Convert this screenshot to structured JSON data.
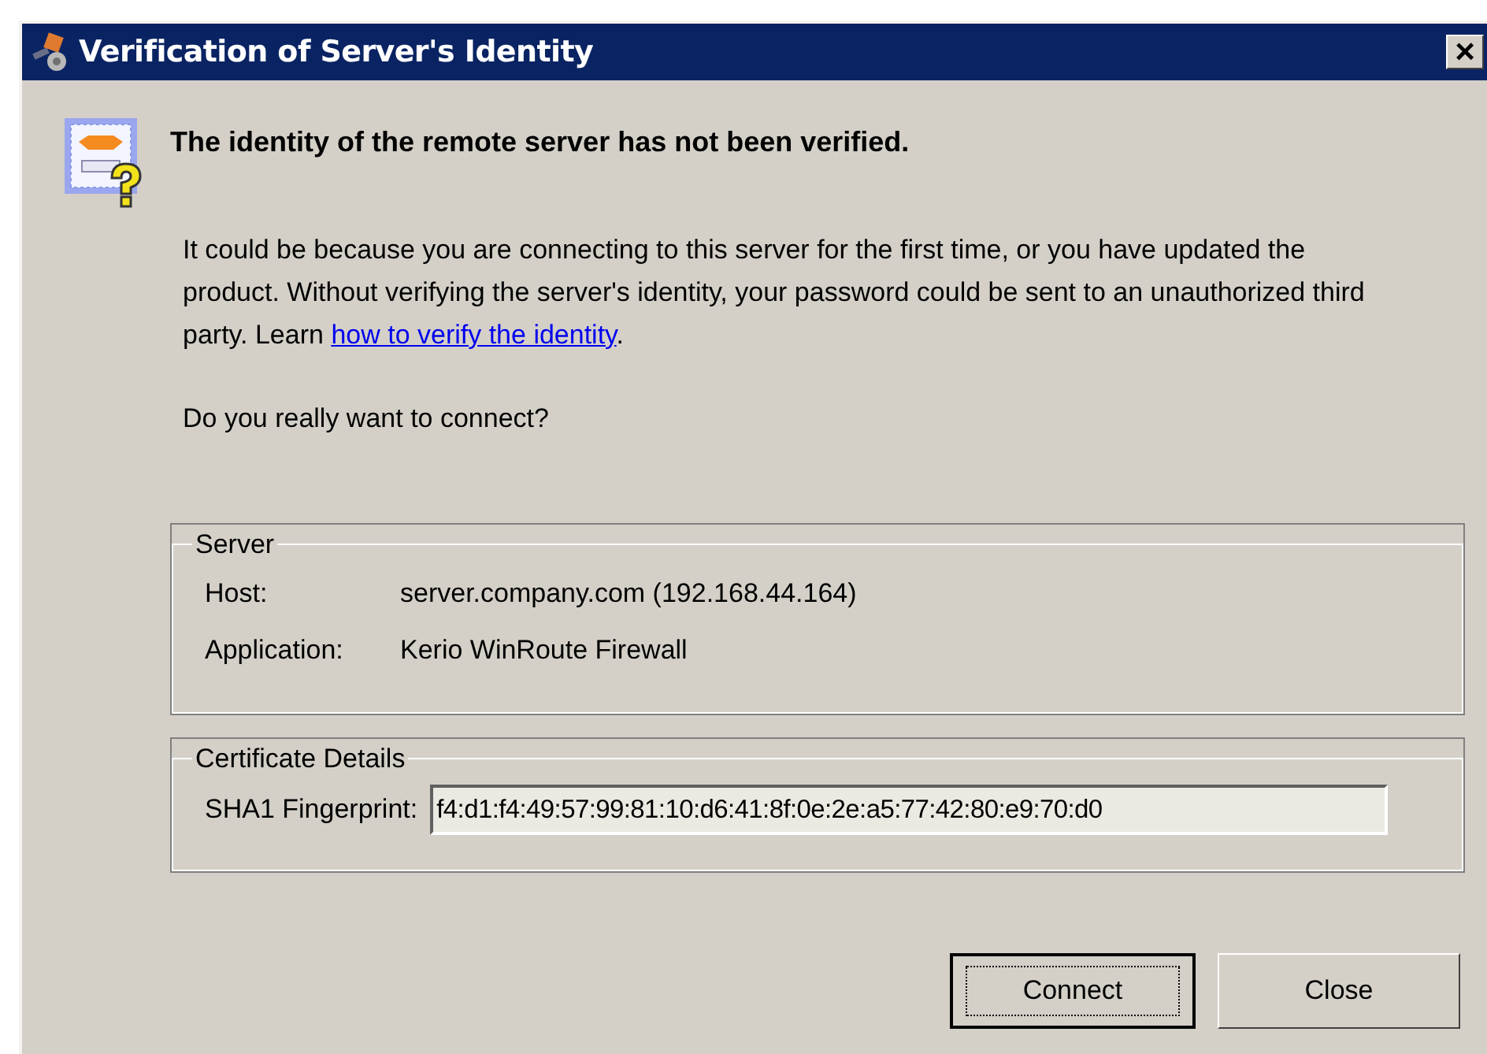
{
  "window": {
    "title": "Verification of Server's Identity",
    "close_label": "×"
  },
  "heading": "The identity of the remote server has not been verified.",
  "message": {
    "text": "It could be because you are connecting to this server for the first time, or you have updated the product. Without verifying the server's identity, your password could be sent to an unauthorized third party. Learn ",
    "link": "how to verify the identity",
    "after": "."
  },
  "question": "Do you really want to connect?",
  "server": {
    "legend": "Server",
    "rows": [
      {
        "label": "Host:",
        "value": "server.company.com (192.168.44.164)"
      },
      {
        "label": "Application:",
        "value": "Kerio WinRoute Firewall"
      }
    ]
  },
  "certificate": {
    "legend": "Certificate Details",
    "label": "SHA1 Fingerprint:",
    "value": "f4:d1:f4:49:57:99:81:10:d6:41:8f:0e:2e:a5:77:42:80:e9:70:d0"
  },
  "buttons": [
    {
      "label": "Connect",
      "default": true
    },
    {
      "label": "Close",
      "default": false
    }
  ]
}
